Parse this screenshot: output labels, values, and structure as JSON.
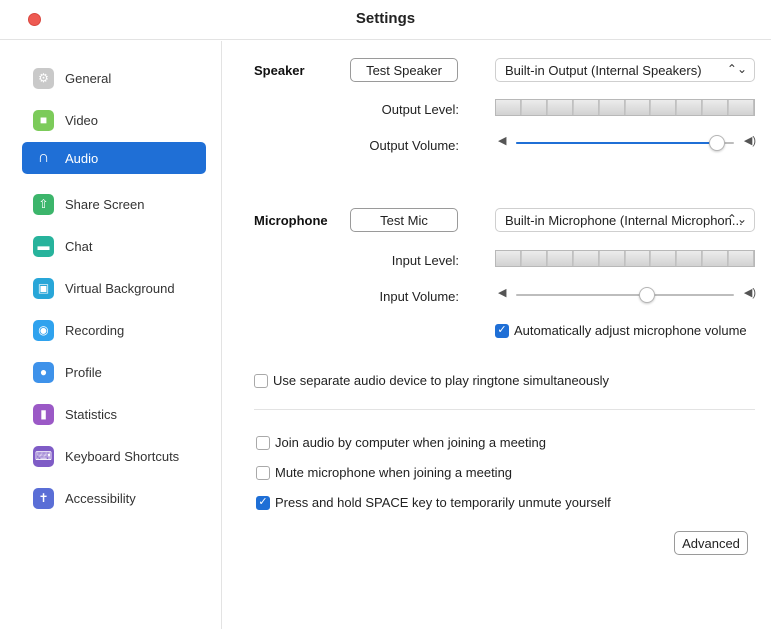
{
  "window": {
    "title": "Settings"
  },
  "sidebar": {
    "items": [
      {
        "label": "General",
        "icon": "gear-icon",
        "color": "#c9c9c9",
        "glyph": "⚙"
      },
      {
        "label": "Video",
        "icon": "video-camera-icon",
        "color": "#7ccb5a",
        "glyph": "■"
      },
      {
        "label": "Audio",
        "icon": "headphones-icon",
        "color": "#1f6fd6",
        "glyph": "∩",
        "active": true
      },
      {
        "label": "Share Screen",
        "icon": "share-screen-icon",
        "color": "#3cb56b",
        "glyph": "⇧"
      },
      {
        "label": "Chat",
        "icon": "chat-bubble-icon",
        "color": "#27b39c",
        "glyph": "▬"
      },
      {
        "label": "Virtual Background",
        "icon": "virtual-background-icon",
        "color": "#28a6d8",
        "glyph": "▣"
      },
      {
        "label": "Recording",
        "icon": "recording-icon",
        "color": "#2fa2ee",
        "glyph": "◉"
      },
      {
        "label": "Profile",
        "icon": "profile-icon",
        "color": "#3e92ea",
        "glyph": "●"
      },
      {
        "label": "Statistics",
        "icon": "statistics-icon",
        "color": "#9b59c6",
        "glyph": "▮"
      },
      {
        "label": "Keyboard Shortcuts",
        "icon": "keyboard-icon",
        "color": "#7f5cc6",
        "glyph": "⌨"
      },
      {
        "label": "Accessibility",
        "icon": "accessibility-icon",
        "color": "#5a6ed6",
        "glyph": "✝"
      }
    ]
  },
  "speaker": {
    "section_label": "Speaker",
    "test_button": "Test Speaker",
    "device": "Built-in Output (Internal Speakers)",
    "output_level_label": "Output Level:",
    "output_volume_label": "Output Volume:",
    "output_volume_value": 0.92
  },
  "microphone": {
    "section_label": "Microphone",
    "test_button": "Test Mic",
    "device": "Built-in Microphone (Internal Microphon...",
    "input_level_label": "Input Level:",
    "input_volume_label": "Input Volume:",
    "input_volume_value": 0.6,
    "auto_adjust_label": "Automatically adjust microphone volume",
    "auto_adjust_checked": true
  },
  "options": {
    "separate_ringtone_label": "Use separate audio device to play ringtone simultaneously",
    "separate_ringtone_checked": false,
    "join_audio_label": "Join audio by computer when joining a meeting",
    "join_audio_checked": false,
    "mute_mic_label": "Mute microphone when joining a meeting",
    "mute_mic_checked": false,
    "space_unmute_label": "Press and hold SPACE key to temporarily unmute yourself",
    "space_unmute_checked": true
  },
  "advanced_button": "Advanced",
  "accent_color": "#1f6fd6"
}
